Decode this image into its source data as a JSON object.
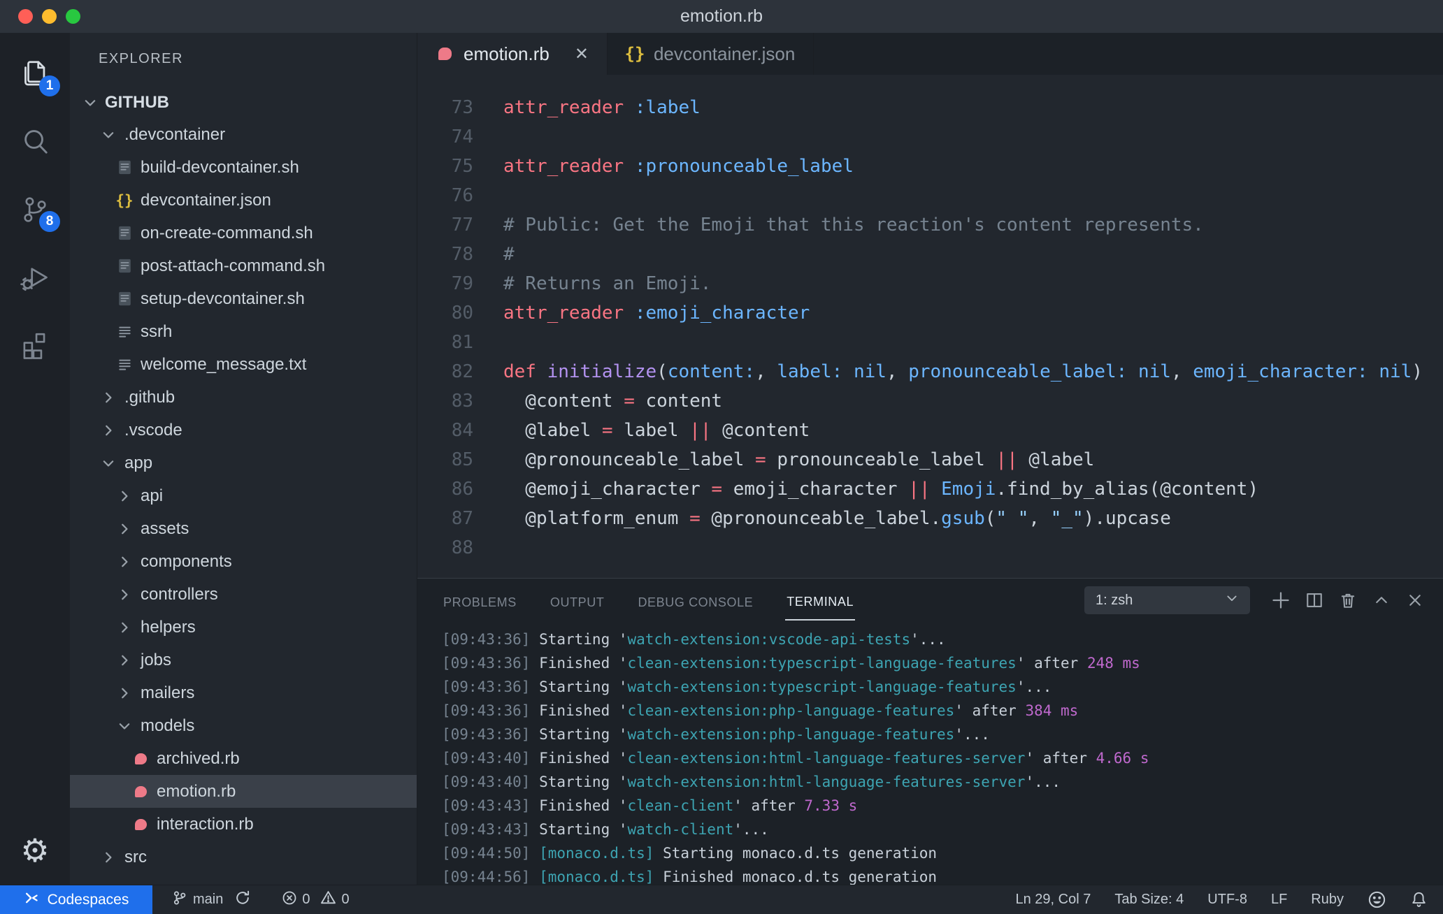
{
  "window": {
    "title": "emotion.rb"
  },
  "activity_bar": {
    "items": [
      {
        "id": "explorer",
        "badge": "1",
        "active": true
      },
      {
        "id": "search",
        "active": false
      },
      {
        "id": "source-control",
        "badge": "8",
        "active": false
      },
      {
        "id": "run-debug",
        "active": false
      },
      {
        "id": "extensions",
        "active": false
      }
    ]
  },
  "sidebar": {
    "header": "EXPLORER",
    "root": "GITHUB",
    "tree": [
      {
        "label": ".devcontainer",
        "type": "folder",
        "state": "open",
        "level": 1
      },
      {
        "label": "build-devcontainer.sh",
        "type": "shell",
        "level": 2
      },
      {
        "label": "devcontainer.json",
        "type": "json",
        "level": 2
      },
      {
        "label": "on-create-command.sh",
        "type": "shell",
        "level": 2
      },
      {
        "label": "post-attach-command.sh",
        "type": "shell",
        "level": 2
      },
      {
        "label": "setup-devcontainer.sh",
        "type": "shell",
        "level": 2
      },
      {
        "label": "ssrh",
        "type": "text",
        "level": 2
      },
      {
        "label": "welcome_message.txt",
        "type": "text",
        "level": 2
      },
      {
        "label": ".github",
        "type": "folder",
        "state": "closed",
        "level": 1
      },
      {
        "label": ".vscode",
        "type": "folder",
        "state": "closed",
        "level": 1
      },
      {
        "label": "app",
        "type": "folder",
        "state": "open",
        "level": 1
      },
      {
        "label": "api",
        "type": "folder",
        "state": "closed",
        "level": 2
      },
      {
        "label": "assets",
        "type": "folder",
        "state": "closed",
        "level": 2
      },
      {
        "label": "components",
        "type": "folder",
        "state": "closed",
        "level": 2
      },
      {
        "label": "controllers",
        "type": "folder",
        "state": "closed",
        "level": 2
      },
      {
        "label": "helpers",
        "type": "folder",
        "state": "closed",
        "level": 2
      },
      {
        "label": "jobs",
        "type": "folder",
        "state": "closed",
        "level": 2
      },
      {
        "label": "mailers",
        "type": "folder",
        "state": "closed",
        "level": 2
      },
      {
        "label": "models",
        "type": "folder",
        "state": "open",
        "level": 2
      },
      {
        "label": "archived.rb",
        "type": "ruby",
        "level": 3
      },
      {
        "label": "emotion.rb",
        "type": "ruby",
        "level": 3,
        "selected": true
      },
      {
        "label": "interaction.rb",
        "type": "ruby",
        "level": 3
      },
      {
        "label": "src",
        "type": "folder",
        "state": "closed",
        "level": 1
      }
    ]
  },
  "editor": {
    "tabs": [
      {
        "label": "emotion.rb",
        "icon": "ruby",
        "active": true,
        "close_glyph": "✕"
      },
      {
        "label": "devcontainer.json",
        "icon": "json",
        "active": false
      }
    ],
    "lines": [
      {
        "n": "73",
        "tokens": [
          [
            "kw",
            "attr_reader"
          ],
          [
            "pl",
            " "
          ],
          [
            "bl",
            ":label"
          ]
        ]
      },
      {
        "n": "74",
        "tokens": []
      },
      {
        "n": "75",
        "tokens": [
          [
            "kw",
            "attr_reader"
          ],
          [
            "pl",
            " "
          ],
          [
            "bl",
            ":pronounceable_label"
          ]
        ]
      },
      {
        "n": "76",
        "tokens": []
      },
      {
        "n": "77",
        "tokens": [
          [
            "cm",
            "# Public: Get the Emoji that this reaction's content represents."
          ]
        ]
      },
      {
        "n": "78",
        "tokens": [
          [
            "cm",
            "#"
          ]
        ]
      },
      {
        "n": "79",
        "tokens": [
          [
            "cm",
            "# Returns an Emoji."
          ]
        ]
      },
      {
        "n": "80",
        "tokens": [
          [
            "kw",
            "attr_reader"
          ],
          [
            "pl",
            " "
          ],
          [
            "bl",
            ":emoji_character"
          ]
        ]
      },
      {
        "n": "81",
        "tokens": []
      },
      {
        "n": "82",
        "tokens": [
          [
            "kw",
            "def"
          ],
          [
            "pl",
            " "
          ],
          [
            "fn",
            "initialize"
          ],
          [
            "pl",
            "("
          ],
          [
            "bl",
            "content:"
          ],
          [
            "pl",
            ", "
          ],
          [
            "bl",
            "label:"
          ],
          [
            "pl",
            " "
          ],
          [
            "bl",
            "nil"
          ],
          [
            "pl",
            ", "
          ],
          [
            "bl",
            "pronounceable_label:"
          ],
          [
            "pl",
            " "
          ],
          [
            "bl",
            "nil"
          ],
          [
            "pl",
            ", "
          ],
          [
            "bl",
            "emoji_character:"
          ],
          [
            "pl",
            " "
          ],
          [
            "bl",
            "nil"
          ],
          [
            "pl",
            ")"
          ]
        ]
      },
      {
        "n": "83",
        "tokens": [
          [
            "pl",
            "  @content "
          ],
          [
            "kw",
            "="
          ],
          [
            "pl",
            " content"
          ]
        ]
      },
      {
        "n": "84",
        "tokens": [
          [
            "pl",
            "  @label "
          ],
          [
            "kw",
            "="
          ],
          [
            "pl",
            " label "
          ],
          [
            "kw",
            "||"
          ],
          [
            "pl",
            " @content"
          ]
        ]
      },
      {
        "n": "85",
        "tokens": [
          [
            "pl",
            "  @pronounceable_label "
          ],
          [
            "kw",
            "="
          ],
          [
            "pl",
            " pronounceable_label "
          ],
          [
            "kw",
            "||"
          ],
          [
            "pl",
            " @label"
          ]
        ]
      },
      {
        "n": "86",
        "tokens": [
          [
            "pl",
            "  @emoji_character "
          ],
          [
            "kw",
            "="
          ],
          [
            "pl",
            " emoji_character "
          ],
          [
            "kw",
            "||"
          ],
          [
            "pl",
            " "
          ],
          [
            "bl",
            "Emoji"
          ],
          [
            "pl",
            ".find_by_alias(@content)"
          ]
        ]
      },
      {
        "n": "87",
        "tokens": [
          [
            "pl",
            "  @platform_enum "
          ],
          [
            "kw",
            "="
          ],
          [
            "pl",
            " @pronounceable_label."
          ],
          [
            "bl",
            "gsub"
          ],
          [
            "pl",
            "("
          ],
          [
            "st",
            "\" \""
          ],
          [
            "pl",
            ", "
          ],
          [
            "st",
            "\"_\""
          ],
          [
            "pl",
            ").upcase"
          ]
        ]
      },
      {
        "n": "88",
        "tokens": []
      }
    ]
  },
  "panel": {
    "tabs": [
      {
        "label": "PROBLEMS",
        "active": false
      },
      {
        "label": "OUTPUT",
        "active": false
      },
      {
        "label": "DEBUG CONSOLE",
        "active": false
      },
      {
        "label": "TERMINAL",
        "active": true
      }
    ],
    "shell_select": "1: zsh",
    "terminal_lines": [
      {
        "tokens": [
          [
            "tg",
            "[09:43:36] "
          ],
          [
            "tw",
            "Starting '"
          ],
          [
            "tt",
            "watch-extension:vscode-api-tests"
          ],
          [
            "tw",
            "'..."
          ]
        ]
      },
      {
        "tokens": [
          [
            "tg",
            "[09:43:36] "
          ],
          [
            "tw",
            "Finished '"
          ],
          [
            "tt",
            "clean-extension:typescript-language-features"
          ],
          [
            "tw",
            "' after "
          ],
          [
            "tm",
            "248 ms"
          ]
        ]
      },
      {
        "tokens": [
          [
            "tg",
            "[09:43:36] "
          ],
          [
            "tw",
            "Starting '"
          ],
          [
            "tt",
            "watch-extension:typescript-language-features"
          ],
          [
            "tw",
            "'..."
          ]
        ]
      },
      {
        "tokens": [
          [
            "tg",
            "[09:43:36] "
          ],
          [
            "tw",
            "Finished '"
          ],
          [
            "tt",
            "clean-extension:php-language-features"
          ],
          [
            "tw",
            "' after "
          ],
          [
            "tm",
            "384 ms"
          ]
        ]
      },
      {
        "tokens": [
          [
            "tg",
            "[09:43:36] "
          ],
          [
            "tw",
            "Starting '"
          ],
          [
            "tt",
            "watch-extension:php-language-features"
          ],
          [
            "tw",
            "'..."
          ]
        ]
      },
      {
        "tokens": [
          [
            "tg",
            "[09:43:40] "
          ],
          [
            "tw",
            "Finished '"
          ],
          [
            "tt",
            "clean-extension:html-language-features-server"
          ],
          [
            "tw",
            "' after "
          ],
          [
            "tm",
            "4.66 s"
          ]
        ]
      },
      {
        "tokens": [
          [
            "tg",
            "[09:43:40] "
          ],
          [
            "tw",
            "Starting '"
          ],
          [
            "tt",
            "watch-extension:html-language-features-server"
          ],
          [
            "tw",
            "'..."
          ]
        ]
      },
      {
        "tokens": [
          [
            "tg",
            "[09:43:43] "
          ],
          [
            "tw",
            "Finished '"
          ],
          [
            "tt",
            "clean-client"
          ],
          [
            "tw",
            "' after "
          ],
          [
            "tm",
            "7.33 s"
          ]
        ]
      },
      {
        "tokens": [
          [
            "tg",
            "[09:43:43] "
          ],
          [
            "tw",
            "Starting '"
          ],
          [
            "tt",
            "watch-client"
          ],
          [
            "tw",
            "'..."
          ]
        ]
      },
      {
        "tokens": [
          [
            "tg",
            "[09:44:50] "
          ],
          [
            "tt",
            "[monaco.d.ts]"
          ],
          [
            "tw",
            " Starting monaco.d.ts generation"
          ]
        ]
      },
      {
        "tokens": [
          [
            "tg",
            "[09:44:56] "
          ],
          [
            "tt",
            "[monaco.d.ts]"
          ],
          [
            "tw",
            " Finished monaco.d.ts generation"
          ]
        ]
      }
    ]
  },
  "status_bar": {
    "codespaces_label": "Codespaces",
    "branch": "main",
    "errors": "0",
    "warnings": "0",
    "right_items": [
      {
        "id": "line-col",
        "label": "Ln 29, Col 7"
      },
      {
        "id": "tab-size",
        "label": "Tab Size: 4"
      },
      {
        "id": "encoding",
        "label": "UTF-8"
      },
      {
        "id": "eol",
        "label": "LF"
      },
      {
        "id": "language",
        "label": "Ruby"
      }
    ]
  },
  "colors": {
    "titlebar_bg": "#2d333b",
    "activitybar_bg": "#1d2127",
    "sidebar_bg": "#22272e",
    "editor_bg": "#22272e",
    "panel_bg": "#1c2127",
    "badge_blue": "#1f6feb",
    "codespaces_blue": "#1f6feb",
    "ruby_pink": "#ee7a88",
    "json_yellow": "#dcbd3f",
    "syntax_keyword": "#f97583",
    "syntax_blue": "#6cb6ff",
    "syntax_purple": "#b392f0",
    "syntax_comment": "#768390",
    "syntax_string": "#96d0ff",
    "terminal_teal": "#3da4b2",
    "terminal_magenta": "#c069ce"
  }
}
